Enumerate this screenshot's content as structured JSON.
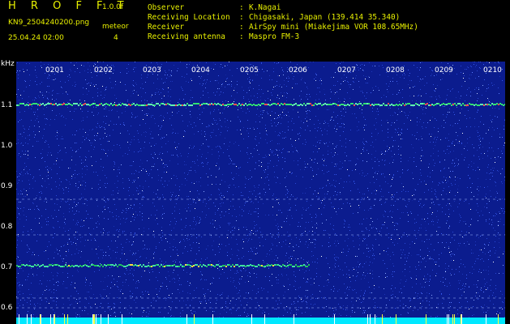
{
  "header": {
    "brand": "H R O F F T",
    "version": "1.0.0f",
    "filename": "KN9_2504240200.png",
    "datetime": "25.04.24 02:00",
    "mode": "meteor",
    "mode_value": "4",
    "fields": [
      {
        "label": "Observer",
        "value": "K.Nagai"
      },
      {
        "label": "Receiving Location",
        "value": "Chigasaki, Japan (139.414 35.340)"
      },
      {
        "label": "Receiver",
        "value": "AirSpy mini (Miakejima VOR 108.65MHz)"
      },
      {
        "label": "Receiving antenna",
        "value": "Maspro FM-3"
      }
    ]
  },
  "axis": {
    "y_unit": "kHz",
    "y_ticks": [
      "1.1",
      "1.0",
      "0.9",
      "0.8",
      "0.7",
      "0.6"
    ],
    "x_ticks": [
      "0201",
      "0202",
      "0203",
      "0204",
      "0205",
      "0206",
      "0207",
      "0208",
      "0209",
      "0210"
    ]
  },
  "colors": {
    "header_yellow": "#e8f000",
    "background": "#0a1a8a",
    "echo_line": "#20c060",
    "bottom_band": "#00e8ff"
  }
}
